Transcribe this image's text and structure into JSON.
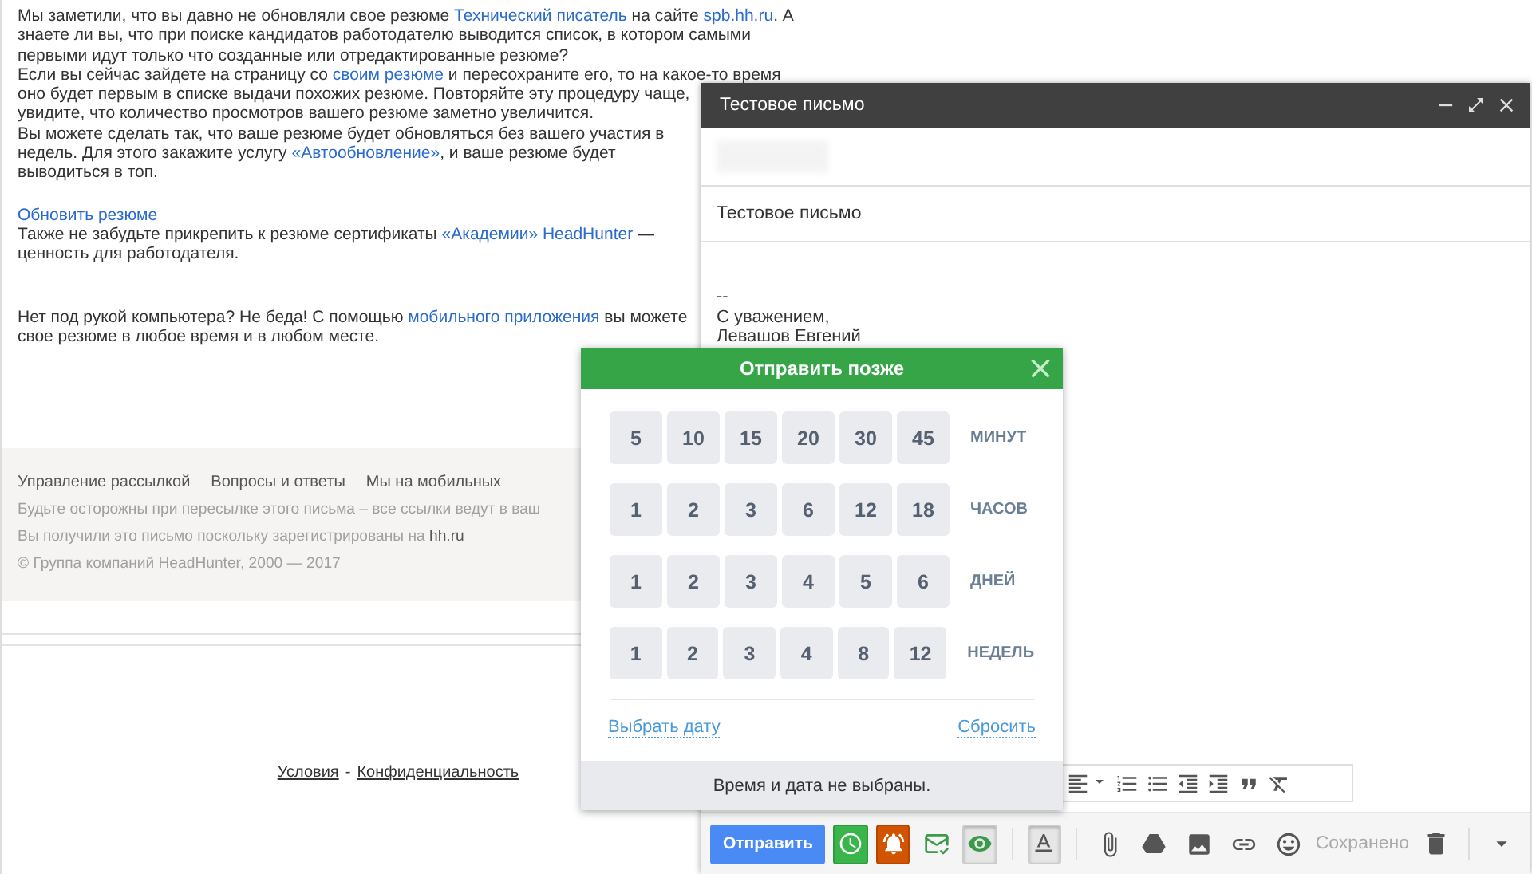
{
  "email": {
    "blocks": [
      {
        "lines": [
          {
            "segments": [
              {
                "text": "Мы заметили, что вы давно не обновляли свое резюме ",
                "link": false
              },
              {
                "text": "Технический писатель",
                "link": true
              },
              {
                "text": " на сайте ",
                "link": false
              },
              {
                "text": "spb.hh.ru",
                "link": true
              },
              {
                "text": ". А",
                "link": false
              }
            ]
          },
          {
            "segments": [
              {
                "text": "знаете ли вы, что при поиске кандидатов работодателю выводится список, в котором самыми",
                "link": false
              }
            ]
          },
          {
            "segments": [
              {
                "text": "первыми идут только что созданные или отредактированные резюме?",
                "link": false
              }
            ]
          },
          {
            "segments": [
              {
                "text": "Если вы сейчас зайдете на страницу со ",
                "link": false
              },
              {
                "text": "своим резюме",
                "link": true
              },
              {
                "text": " и пересохраните его, то на какое-то время",
                "link": false
              }
            ]
          },
          {
            "segments": [
              {
                "text": "оно будет первым в списке выдачи похожих резюме. Повторяйте эту процедуру чаще,",
                "link": false
              }
            ]
          },
          {
            "segments": [
              {
                "text": "увидите, что количество просмотров вашего резюме заметно увеличится.",
                "link": false
              }
            ]
          },
          {
            "segments": [
              {
                "text": "Вы можете сделать так, что ваше резюме будет обновляться без вашего участия в",
                "link": false
              }
            ]
          },
          {
            "segments": [
              {
                "text": "недель. Для этого закажите услугу ",
                "link": false
              },
              {
                "text": "«Автообновление»",
                "link": true
              },
              {
                "text": ", и ваше резюме будет",
                "link": false
              }
            ]
          },
          {
            "segments": [
              {
                "text": "выводиться в топ.",
                "link": false
              }
            ]
          }
        ]
      },
      {
        "lines": [
          {
            "segments": [
              {
                "text": "Обновить резюме",
                "link": true
              }
            ]
          },
          {
            "segments": [
              {
                "text": "Также не забудьте прикрепить к резюме сертификаты ",
                "link": false
              },
              {
                "text": "«Академии» HeadHunter",
                "link": true
              },
              {
                "text": " —",
                "link": false
              }
            ]
          },
          {
            "segments": [
              {
                "text": "ценность для работодателя.",
                "link": false
              }
            ]
          }
        ]
      },
      {
        "lines": [
          {
            "segments": [
              {
                "text": "Нет под рукой компьютера? Не беда! С помощью ",
                "link": false
              },
              {
                "text": "мобильного приложения",
                "link": true
              },
              {
                "text": " вы можете",
                "link": false
              }
            ]
          },
          {
            "segments": [
              {
                "text": "свое резюме в любое время и в любом месте.",
                "link": false
              }
            ]
          }
        ]
      }
    ],
    "footer": {
      "links": [
        "Управление рассылкой",
        "Вопросы и ответы",
        "Мы на мобильных"
      ],
      "notes": [
        "Будьте осторожны при пересылке этого письма – все ссылки ведут в ваш",
        "Вы получили это письмо поскольку зарегистрированы на **hh.ru**"
      ],
      "copyright": "© Группа компаний HeadHunter, 2000 — 2017"
    },
    "bottom_links": {
      "terms": "Условия",
      "separator": "-",
      "privacy": "Конфиденциальность"
    }
  },
  "compose": {
    "title": "Тестовое письмо",
    "subject": "Тестовое письмо",
    "signature": [
      "--",
      "С уважением,",
      "Левашов Евгений"
    ],
    "format_tools": [
      {
        "kind": "align"
      },
      {
        "kind": "numbered"
      },
      {
        "kind": "bulleted"
      },
      {
        "kind": "outdent"
      },
      {
        "kind": "indent"
      },
      {
        "kind": "quote"
      },
      {
        "kind": "clear"
      }
    ],
    "send_button": "Отправить",
    "schedule_tools": [
      {
        "kind": "clock",
        "active": false
      },
      {
        "kind": "bell",
        "active": false
      },
      {
        "kind": "envelope",
        "active": false
      },
      {
        "kind": "eye",
        "active": true
      }
    ],
    "format_toggle": {
      "active": true
    },
    "insert_tools": [
      {
        "kind": "attach"
      },
      {
        "kind": "drive"
      },
      {
        "kind": "photo"
      },
      {
        "kind": "link"
      },
      {
        "kind": "emoji"
      }
    ],
    "status": "Сохранено"
  },
  "schedule": {
    "title": "Отправить позже",
    "rows": [
      {
        "unit": "МИНУТ",
        "options": [
          "5",
          "10",
          "15",
          "20",
          "30",
          "45"
        ]
      },
      {
        "unit": "ЧАСОВ",
        "options": [
          "1",
          "2",
          "3",
          "6",
          "12",
          "18"
        ]
      },
      {
        "unit": "ДНЕЙ",
        "options": [
          "1",
          "2",
          "3",
          "4",
          "5",
          "6"
        ]
      },
      {
        "unit": "НЕДЕЛЬ",
        "options": [
          "1",
          "2",
          "3",
          "4",
          "8",
          "12"
        ]
      }
    ],
    "pick_date": "Выбрать дату",
    "reset": "Сбросить",
    "status": "Время и дата не выбраны."
  }
}
